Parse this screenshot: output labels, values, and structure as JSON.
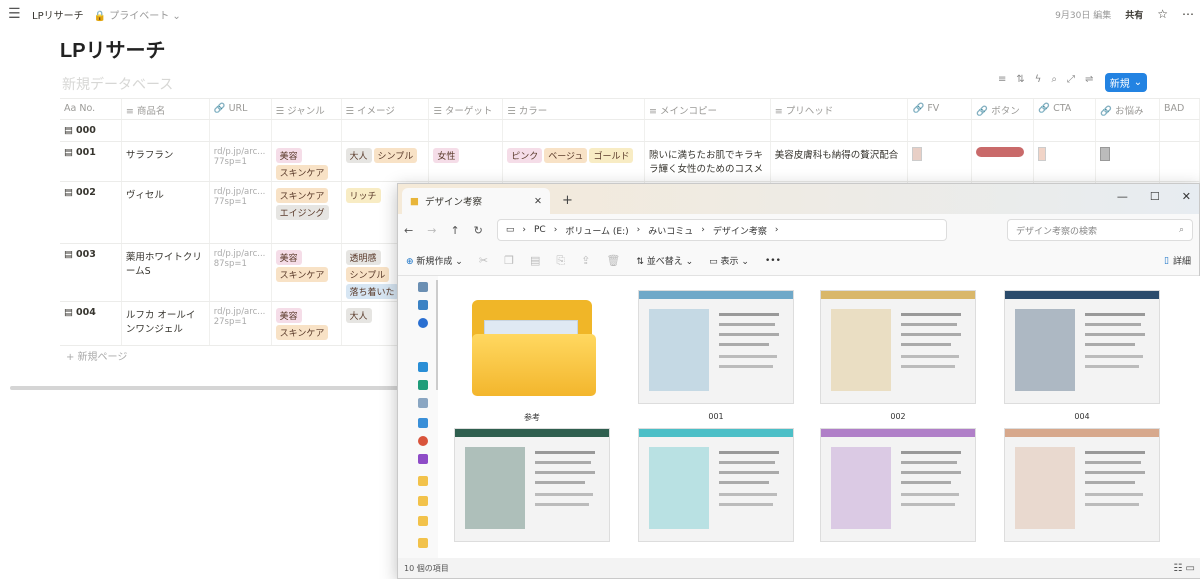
{
  "topbar": {
    "menu_icon": "hamburger-icon",
    "breadcrumb": "LPリサーチ",
    "privacy": "プライベート",
    "edited": "9月30日 編集",
    "share": "共有"
  },
  "page": {
    "title": "LPリサーチ",
    "db_title": "新規データベース",
    "new_button": "新規",
    "add_page": "+ 新規ページ"
  },
  "table": {
    "columns": [
      "No.",
      "商品名",
      "URL",
      "ジャンル",
      "イメージ",
      "ターゲット",
      "カラー",
      "メインコピー",
      "プリヘッド",
      "FV",
      "ボタン",
      "CTA",
      "お悩み",
      "BAD"
    ],
    "rows": [
      {
        "no": "000",
        "name": "",
        "url": "",
        "url2": "",
        "genre": [],
        "image": [],
        "target": [],
        "color": [],
        "copy": "",
        "prehead": ""
      },
      {
        "no": "001",
        "name": "サラフラン",
        "url": "rd/p.jp/arc...",
        "url2": "77sp=1",
        "genre": [
          "美容",
          "スキンケア"
        ],
        "image": [
          "大人",
          "シンプル"
        ],
        "target": [
          "女性"
        ],
        "color": [
          "ピンク",
          "ベージュ",
          "ゴールド"
        ],
        "copy": "隙いに満ちたお肌でキラキラ輝く女性のためのコスメ",
        "prehead": "美容皮膚科も納得の贅沢配合"
      },
      {
        "no": "002",
        "name": "ヴィセル",
        "url": "rd/p.jp/arc...",
        "url2": "77sp=1",
        "genre": [
          "スキンケア",
          "エイジング"
        ],
        "image": [
          "リッチ"
        ],
        "target": [],
        "color": [],
        "copy": "",
        "prehead": ""
      },
      {
        "no": "003",
        "name": "薬用ホワイトクリームS",
        "url": "rd/p.jp/arc...",
        "url2": "87sp=1",
        "genre": [
          "美容",
          "スキンケア"
        ],
        "image": [
          "透明感",
          "シンプル",
          "落ち着いた"
        ],
        "target": [],
        "color": [],
        "copy": "",
        "prehead": ""
      },
      {
        "no": "004",
        "name": "ルフカ オールインワンジェル",
        "url": "rd/p.jp/arc...",
        "url2": "27sp=1",
        "genre": [
          "美容",
          "スキンケア"
        ],
        "image": [
          "大人"
        ],
        "target": [],
        "color": [],
        "copy": "",
        "prehead": ""
      }
    ]
  },
  "explorer": {
    "tab_title": "デザイン考察",
    "path": [
      "PC",
      "ボリューム (E:)",
      "みいコミュ",
      "デザイン考察"
    ],
    "search_placeholder": "デザイン考察の検索",
    "commands": {
      "new": "新規作成",
      "sort": "並べ替え",
      "view": "表示",
      "more": "•••",
      "details": "詳細"
    },
    "items": [
      {
        "label": "参考",
        "kind": "folder"
      },
      {
        "label": "001",
        "kind": "image",
        "accent": "#6fa8c8"
      },
      {
        "label": "002",
        "kind": "image",
        "accent": "#d9b76a"
      },
      {
        "label": "004",
        "kind": "image",
        "accent": "#2b4b6b"
      },
      {
        "label": "",
        "kind": "image",
        "accent": "#2f5f4f"
      },
      {
        "label": "",
        "kind": "image",
        "accent": "#4cbfc7"
      },
      {
        "label": "",
        "kind": "image",
        "accent": "#b07fc8"
      },
      {
        "label": "",
        "kind": "image",
        "accent": "#d7a88c"
      }
    ],
    "status": "10 個の項目"
  }
}
